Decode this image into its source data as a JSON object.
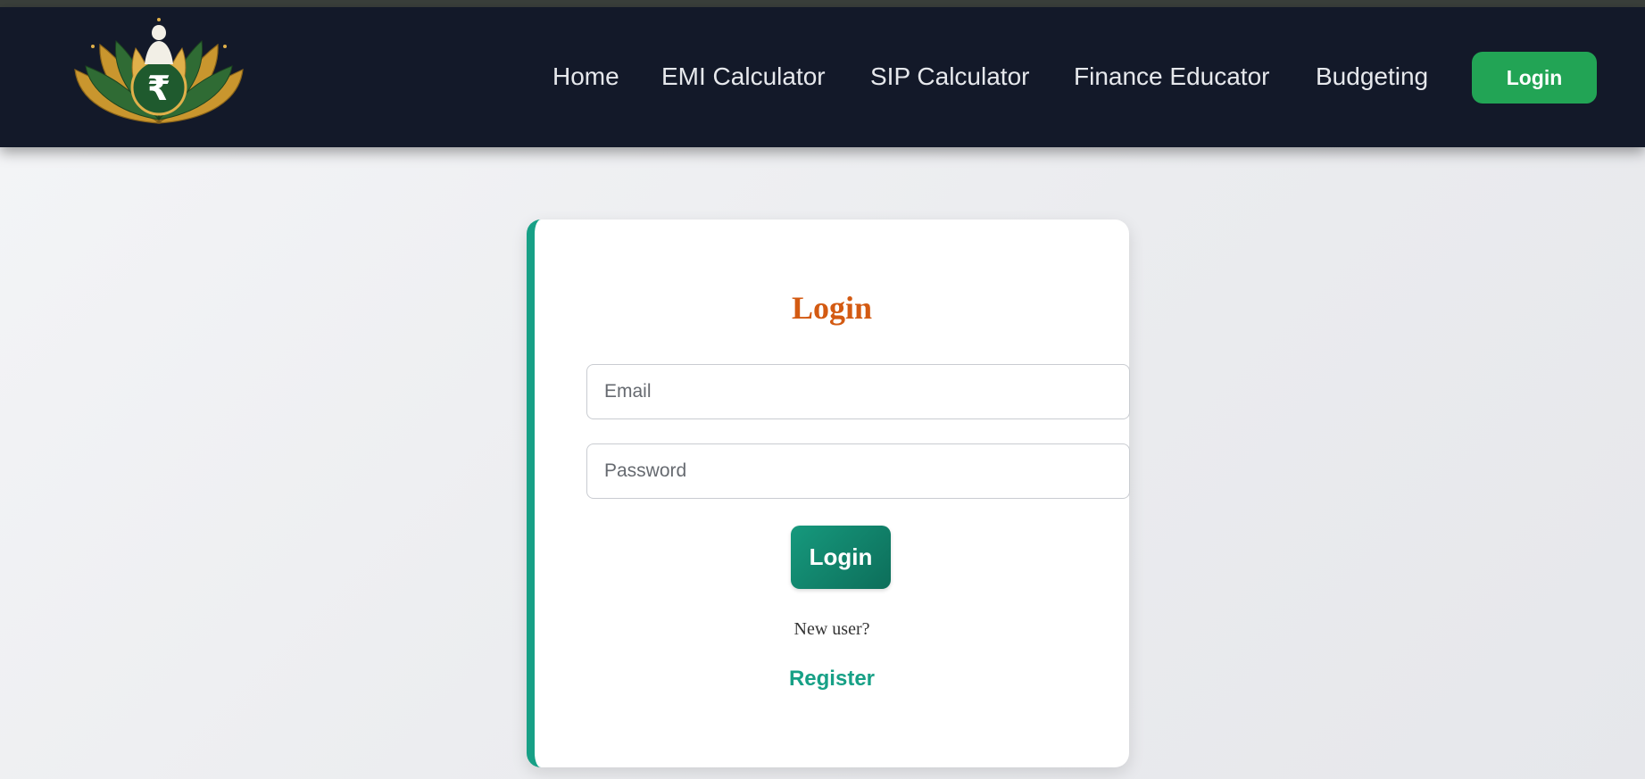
{
  "header": {
    "logo_icon": "lotus-rupee-logo-icon",
    "nav": {
      "home": "Home",
      "emi": "EMI Calculator",
      "sip": "SIP Calculator",
      "educator": "Finance Educator",
      "budgeting": "Budgeting"
    },
    "login_button": "Login"
  },
  "login_card": {
    "title": "Login",
    "email_placeholder": "Email",
    "password_placeholder": "Password",
    "submit_label": "Login",
    "new_user_text": "New user?",
    "register_link": "Register"
  },
  "colors": {
    "navbar": "#131929",
    "accent_green": "#22a455",
    "teal": "#17a086",
    "title_orange": "#d35a12"
  }
}
